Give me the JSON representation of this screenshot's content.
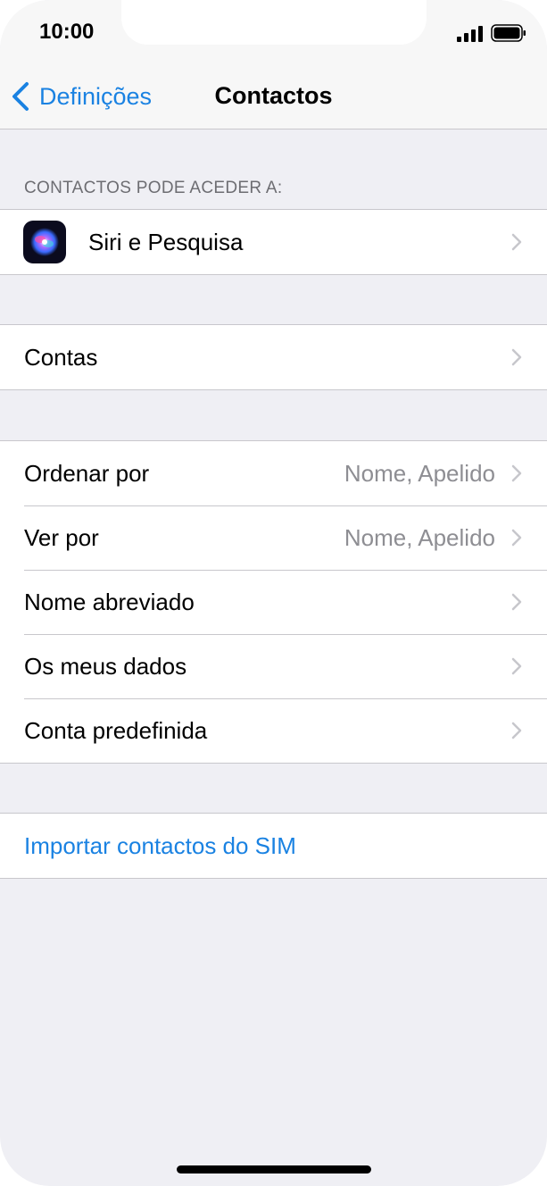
{
  "status_bar": {
    "time": "10:00",
    "icons": [
      "signal-icon",
      "battery-icon"
    ]
  },
  "nav": {
    "back_label": "Definições",
    "title": "Contactos"
  },
  "access_section": {
    "header": "CONTACTOS PODE ACEDER A:",
    "items": [
      {
        "label": "Siri e Pesquisa",
        "icon": "siri-icon"
      }
    ]
  },
  "accounts_section": {
    "items": [
      {
        "label": "Contas"
      }
    ]
  },
  "display_section": {
    "items": [
      {
        "label": "Ordenar por",
        "value": "Nome, Apelido"
      },
      {
        "label": "Ver por",
        "value": "Nome, Apelido"
      },
      {
        "label": "Nome abreviado"
      },
      {
        "label": "Os meus dados"
      },
      {
        "label": "Conta predefinida"
      }
    ]
  },
  "sim_section": {
    "action_label": "Importar contactos do SIM"
  },
  "colors": {
    "accent": "#1a82e2",
    "background": "#efeff4",
    "secondary_text": "#8e8e93"
  }
}
